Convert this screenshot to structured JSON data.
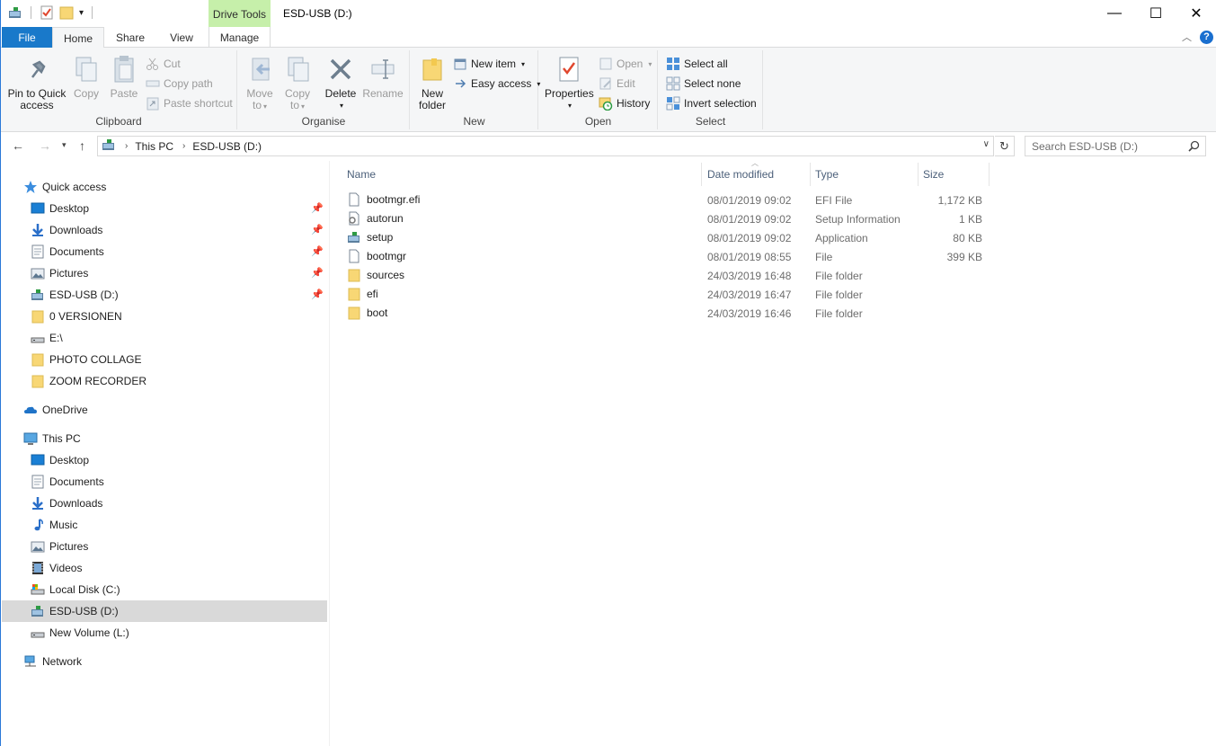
{
  "window": {
    "title": "ESD-USB (D:)",
    "context_tab_group": "Drive Tools",
    "minimize_glyph": "—",
    "maximize_glyph": "☐",
    "close_glyph": "✕"
  },
  "tabs": {
    "file": "File",
    "home": "Home",
    "share": "Share",
    "view": "View",
    "manage": "Manage"
  },
  "ribbon": {
    "clipboard": {
      "label": "Clipboard",
      "pin": "Pin to Quick access",
      "pin_line1": "Pin to Quick",
      "pin_line2": "access",
      "copy": "Copy",
      "paste": "Paste",
      "cut": "Cut",
      "copy_path": "Copy path",
      "paste_shortcut": "Paste shortcut"
    },
    "organise": {
      "label": "Organise",
      "move_to_line1": "Move",
      "move_to_line2": "to",
      "copy_to_line1": "Copy",
      "copy_to_line2": "to",
      "delete": "Delete",
      "rename": "Rename"
    },
    "new": {
      "label": "New",
      "new_folder_line1": "New",
      "new_folder_line2": "folder",
      "new_item": "New item",
      "easy_access": "Easy access"
    },
    "open": {
      "label": "Open",
      "properties": "Properties",
      "open": "Open",
      "edit": "Edit",
      "history": "History"
    },
    "select": {
      "label": "Select",
      "select_all": "Select all",
      "select_none": "Select none",
      "invert_selection": "Invert selection"
    }
  },
  "address": {
    "crumbs": [
      "This PC",
      "ESD-USB (D:)"
    ],
    "search_placeholder": "Search ESD-USB (D:)"
  },
  "nav": {
    "quick_access": "Quick access",
    "quick_items": [
      {
        "label": "Desktop",
        "icon": "desktop-icon",
        "pinned": true
      },
      {
        "label": "Downloads",
        "icon": "downloads-icon",
        "pinned": true
      },
      {
        "label": "Documents",
        "icon": "documents-icon",
        "pinned": true
      },
      {
        "label": "Pictures",
        "icon": "pictures-icon",
        "pinned": true
      },
      {
        "label": "ESD-USB (D:)",
        "icon": "usb-drive-icon",
        "pinned": true
      },
      {
        "label": "0 VERSIONEN",
        "icon": "folder-icon",
        "pinned": false
      },
      {
        "label": "E:\\",
        "icon": "drive-icon",
        "pinned": false
      },
      {
        "label": "PHOTO COLLAGE",
        "icon": "folder-icon",
        "pinned": false
      },
      {
        "label": "ZOOM RECORDER",
        "icon": "folder-icon",
        "pinned": false
      }
    ],
    "onedrive": "OneDrive",
    "this_pc": "This PC",
    "pc_items": [
      {
        "label": "Desktop",
        "icon": "desktop-icon"
      },
      {
        "label": "Documents",
        "icon": "documents-icon"
      },
      {
        "label": "Downloads",
        "icon": "downloads-icon"
      },
      {
        "label": "Music",
        "icon": "music-icon"
      },
      {
        "label": "Pictures",
        "icon": "pictures-icon"
      },
      {
        "label": "Videos",
        "icon": "videos-icon"
      },
      {
        "label": "Local Disk (C:)",
        "icon": "local-disk-icon"
      },
      {
        "label": "ESD-USB (D:)",
        "icon": "usb-drive-icon",
        "selected": true
      },
      {
        "label": "New Volume (L:)",
        "icon": "drive-icon"
      }
    ],
    "network": "Network"
  },
  "files": {
    "columns": {
      "name": "Name",
      "date": "Date modified",
      "type": "Type",
      "size": "Size"
    },
    "rows": [
      {
        "name": "bootmgr.efi",
        "date": "08/01/2019 09:02",
        "type": "EFI File",
        "size": "1,172 KB",
        "icon": "file-icon"
      },
      {
        "name": "autorun",
        "date": "08/01/2019 09:02",
        "type": "Setup Information",
        "size": "1 KB",
        "icon": "setup-info-icon"
      },
      {
        "name": "setup",
        "date": "08/01/2019 09:02",
        "type": "Application",
        "size": "80 KB",
        "icon": "application-icon"
      },
      {
        "name": "bootmgr",
        "date": "08/01/2019 08:55",
        "type": "File",
        "size": "399 KB",
        "icon": "file-icon"
      },
      {
        "name": "sources",
        "date": "24/03/2019 16:48",
        "type": "File folder",
        "size": "",
        "icon": "folder-icon"
      },
      {
        "name": "efi",
        "date": "24/03/2019 16:47",
        "type": "File folder",
        "size": "",
        "icon": "folder-icon"
      },
      {
        "name": "boot",
        "date": "24/03/2019 16:46",
        "type": "File folder",
        "size": "",
        "icon": "folder-icon"
      }
    ]
  },
  "colors": {
    "file_tab": "#1979ca",
    "context_tab": "#c6efaa",
    "selected_nav": "#d9d9d9",
    "folder": "#f8d775"
  }
}
